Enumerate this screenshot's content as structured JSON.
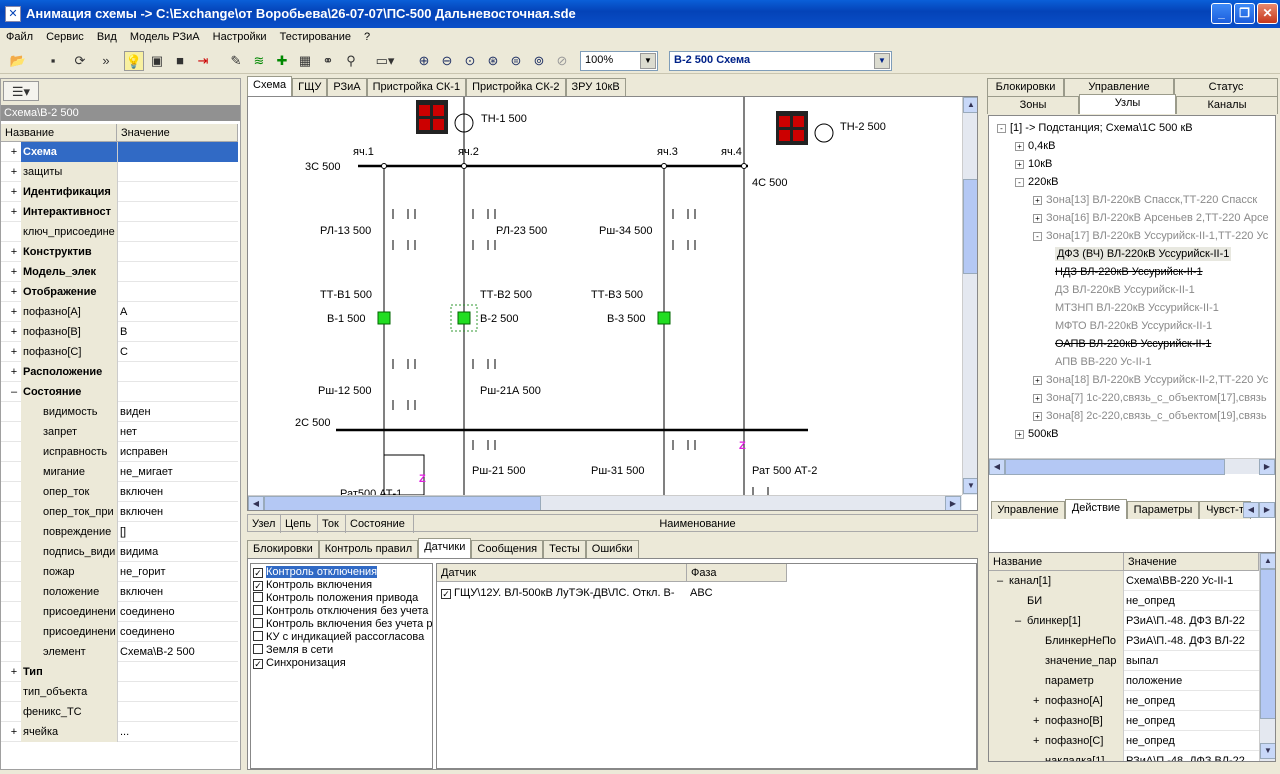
{
  "window": {
    "title": "Анимация схемы -> C:\\Exchange\\от Воробьева\\26-07-07\\ПС-500 Дальневосточная.sde"
  },
  "menu": [
    "Файл",
    "Сервис",
    "Вид",
    "Модель РЗиА",
    "Настройки",
    "Тестирование",
    "?"
  ],
  "toolbar": {
    "zoom": "100%",
    "scheme_select": "В-2 500 Схема"
  },
  "left": {
    "path": "Схема\\В-2 500",
    "col_name": "Название",
    "col_value": "Значение",
    "rows": [
      {
        "exp": "+",
        "name": "Схема",
        "value": "",
        "bold": true,
        "sel": true
      },
      {
        "exp": "+",
        "name": "защиты",
        "value": ""
      },
      {
        "exp": "+",
        "name": "Идентификация",
        "value": "",
        "bold": true
      },
      {
        "exp": "+",
        "name": "Интерактивност",
        "value": "",
        "bold": true
      },
      {
        "exp": "",
        "name": "ключ_присоедине",
        "value": ""
      },
      {
        "exp": "+",
        "name": "Конструктив",
        "value": "",
        "bold": true
      },
      {
        "exp": "+",
        "name": "Модель_элек",
        "value": "",
        "bold": true
      },
      {
        "exp": "+",
        "name": "Отображение",
        "value": "",
        "bold": true
      },
      {
        "exp": "+",
        "name": "пофазно[A]",
        "value": "A"
      },
      {
        "exp": "+",
        "name": "пофазно[B]",
        "value": "B"
      },
      {
        "exp": "+",
        "name": "пофазно[C]",
        "value": "C"
      },
      {
        "exp": "+",
        "name": "Расположение",
        "value": "",
        "bold": true
      },
      {
        "exp": "–",
        "name": "Состояние",
        "value": "",
        "bold": true
      },
      {
        "exp": "",
        "name": "видимость",
        "value": "виден",
        "indent": true
      },
      {
        "exp": "",
        "name": "запрет",
        "value": "нет",
        "indent": true
      },
      {
        "exp": "",
        "name": "исправность",
        "value": "исправен",
        "indent": true
      },
      {
        "exp": "",
        "name": "мигание",
        "value": "не_мигает",
        "indent": true
      },
      {
        "exp": "",
        "name": "опер_ток",
        "value": "включен",
        "indent": true
      },
      {
        "exp": "",
        "name": "опер_ток_при",
        "value": "включен",
        "indent": true
      },
      {
        "exp": "",
        "name": "повреждение",
        "value": "[]",
        "indent": true
      },
      {
        "exp": "",
        "name": "подпись_види",
        "value": "видима",
        "indent": true
      },
      {
        "exp": "",
        "name": "пожар",
        "value": "не_горит",
        "indent": true
      },
      {
        "exp": "",
        "name": "положение",
        "value": "включен",
        "indent": true
      },
      {
        "exp": "",
        "name": "присоединени",
        "value": "соединено",
        "indent": true
      },
      {
        "exp": "",
        "name": "присоединени",
        "value": "соединено",
        "indent": true
      },
      {
        "exp": "",
        "name": "элемент",
        "value": "Схема\\В-2 500",
        "indent": true
      },
      {
        "exp": "+",
        "name": "Тип",
        "value": "",
        "bold": true
      },
      {
        "exp": "",
        "name": "тип_объекта",
        "value": ""
      },
      {
        "exp": "",
        "name": "феникс_ТС",
        "value": ""
      },
      {
        "exp": "+",
        "name": "ячейка",
        "value": "..."
      }
    ]
  },
  "center": {
    "tabs": [
      "Схема",
      "ГЩУ",
      "РЗиА",
      "Пристройка СК-1",
      "Пристройка СК-2",
      "ЗРУ 10кВ"
    ],
    "schema_labels": {
      "th1": "ТН-1 500",
      "th2": "ТН-2 500",
      "c1": "яч.1",
      "c2": "яч.2",
      "c3": "яч.3",
      "c4": "яч.4",
      "bus3": "3С 500",
      "bus4": "4С 500",
      "bus2": "2С 500",
      "rl13": "РЛ-13 500",
      "rl23": "РЛ-23 500",
      "rsh34": "Рш-34 500",
      "ttb1": "ТТ-В1 500",
      "ttb2": "ТТ-В2 500",
      "ttb3": "ТТ-В3 500",
      "b1": "В-1 500",
      "b2": "В-2 500",
      "b3": "В-3 500",
      "rsh12": "Рш-12 500",
      "rsh21a": "Рш-21А 500",
      "rsh21": "Рш-21 500",
      "rsh31": "Рш-31 500",
      "rat": "Рат 500 АТ-2",
      "rat1": "Рат500 АТ-1",
      "z": "Z"
    },
    "footer": [
      "Узел",
      "Цепь",
      "Ток",
      "Состояние",
      "Наименование"
    ],
    "bottom_tabs": [
      "Блокировки",
      "Контроль правил",
      "Датчики",
      "Сообщения",
      "Тесты",
      "Ошибки"
    ],
    "checks": [
      {
        "label": "Контроль отключения",
        "checked": true,
        "sel": true
      },
      {
        "label": "Контроль включения",
        "checked": true
      },
      {
        "label": "Контроль положения привода",
        "checked": false
      },
      {
        "label": "Контроль отключения без учета",
        "checked": false
      },
      {
        "label": "Контроль включения без учета р",
        "checked": false
      },
      {
        "label": "КУ с индикацией рассогласова",
        "checked": false
      },
      {
        "label": "Земля в сети",
        "checked": false
      },
      {
        "label": "Синхронизация",
        "checked": true
      }
    ],
    "sensor_cols": [
      "Датчик",
      "Фаза"
    ],
    "sensors": [
      {
        "name": "ГЩУ\\12У. ВЛ-500кВ ЛуТЭК-ДВ\\ЛС. Откл. В-",
        "phase": "ABC"
      }
    ]
  },
  "right": {
    "tabs_top": [
      "Блокировки",
      "Управление",
      "Статус"
    ],
    "tabs_mid": [
      "Зоны",
      "Узлы",
      "Каналы"
    ],
    "tree": [
      {
        "lvl": 0,
        "exp": "–",
        "text": "[1] -> Подстанция; Схема\\1С 500 кВ"
      },
      {
        "lvl": 1,
        "exp": "+",
        "text": "0,4кВ"
      },
      {
        "lvl": 1,
        "exp": "+",
        "text": "10кВ"
      },
      {
        "lvl": 1,
        "exp": "–",
        "text": "220кВ"
      },
      {
        "lvl": 2,
        "exp": "+",
        "text": "Зона[13] ВЛ-220кВ Спасск,ТТ-220 Спасск",
        "grey": true
      },
      {
        "lvl": 2,
        "exp": "+",
        "text": "Зона[16] ВЛ-220кВ Арсеньев 2,ТТ-220 Арсе",
        "grey": true
      },
      {
        "lvl": 2,
        "exp": "–",
        "text": "Зона[17] ВЛ-220кВ Уссурийск-II-1,ТТ-220 Ус",
        "grey": true
      },
      {
        "lvl": 3,
        "exp": "",
        "text": "ДФЗ (ВЧ) ВЛ-220кВ Уссурийск-II-1",
        "sel": true
      },
      {
        "lvl": 3,
        "exp": "",
        "text": "НДЗ ВЛ-220кВ Уссурийск-II-1",
        "strike": true
      },
      {
        "lvl": 3,
        "exp": "",
        "text": "ДЗ ВЛ-220кВ Уссурийск-II-1",
        "grey": true
      },
      {
        "lvl": 3,
        "exp": "",
        "text": "МТЗНП ВЛ-220кВ Уссурийск-II-1",
        "grey": true
      },
      {
        "lvl": 3,
        "exp": "",
        "text": "МФТО ВЛ-220кВ Уссурийск-II-1",
        "grey": true
      },
      {
        "lvl": 3,
        "exp": "",
        "text": "ОАПВ ВЛ-220кВ Уссурийск-II-1",
        "strike": true
      },
      {
        "lvl": 3,
        "exp": "",
        "text": "АПВ ВВ-220 Ус-II-1",
        "grey": true
      },
      {
        "lvl": 2,
        "exp": "+",
        "text": "Зона[18] ВЛ-220кВ Уссурийск-II-2,ТТ-220 Ус",
        "grey": true
      },
      {
        "lvl": 2,
        "exp": "+",
        "text": "Зона[7] 1с-220,связь_с_объектом[17],связь",
        "grey": true
      },
      {
        "lvl": 2,
        "exp": "+",
        "text": "Зона[8] 2с-220,связь_с_объектом[19],связь",
        "grey": true
      },
      {
        "lvl": 1,
        "exp": "+",
        "text": "500кВ"
      }
    ],
    "tabs_low": [
      "Управление",
      "Действие",
      "Параметры",
      "Чувст-т"
    ],
    "col_name": "Название",
    "col_value": "Значение",
    "props": [
      {
        "ind": 0,
        "exp": "–",
        "name": "канал[1]",
        "value": "Схема\\ВВ-220 Ус-II-1"
      },
      {
        "ind": 1,
        "exp": "",
        "name": "БИ",
        "value": "не_опред"
      },
      {
        "ind": 1,
        "exp": "–",
        "name": "блинкер[1]",
        "value": "РЗиА\\П.-48. ДФЗ ВЛ-22"
      },
      {
        "ind": 2,
        "exp": "",
        "name": "БлинкерНеПо",
        "value": "РЗиА\\П.-48. ДФЗ ВЛ-22"
      },
      {
        "ind": 2,
        "exp": "",
        "name": "значение_пар",
        "value": "выпал"
      },
      {
        "ind": 2,
        "exp": "",
        "name": "параметр",
        "value": "положение"
      },
      {
        "ind": 2,
        "exp": "+",
        "name": "пофазно[A]",
        "value": "не_опред"
      },
      {
        "ind": 2,
        "exp": "+",
        "name": "пофазно[B]",
        "value": "не_опред"
      },
      {
        "ind": 2,
        "exp": "+",
        "name": "пофазно[C]",
        "value": "не_опред"
      },
      {
        "ind": 2,
        "exp": "",
        "name": "накладка[1]",
        "value": "РЗиА\\П.-48. ДФЗ ВЛ-22"
      }
    ]
  }
}
